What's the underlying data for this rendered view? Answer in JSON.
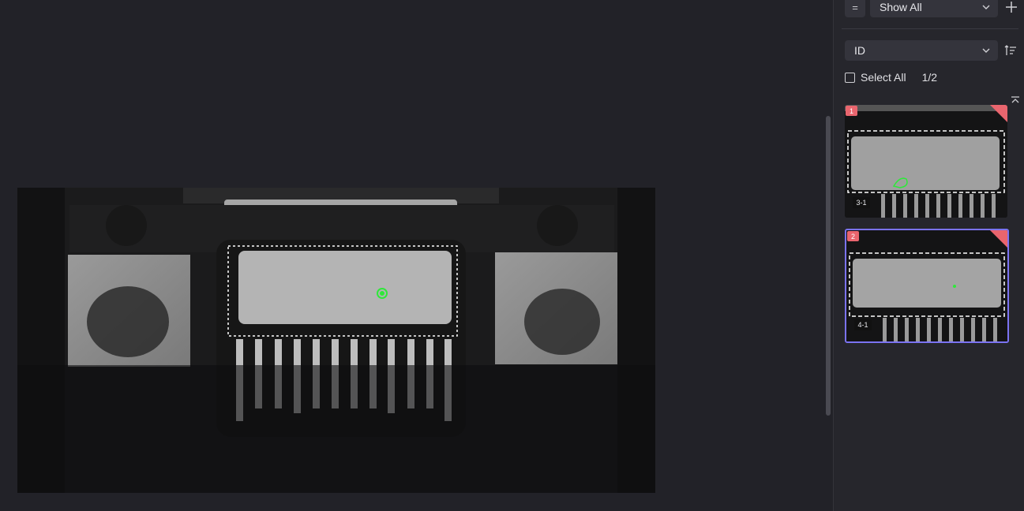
{
  "toolbar": {
    "eq_label": "=",
    "filter_value": "Show All",
    "sort_value": "ID"
  },
  "selection": {
    "select_all_label": "Select All",
    "count": "1/2"
  },
  "thumbnails": [
    {
      "index": "1",
      "label": "3-1",
      "selected": false
    },
    {
      "index": "2",
      "label": "4-1",
      "selected": true
    }
  ],
  "colors": {
    "accent": "#7b73f2",
    "flag": "#e9656e",
    "defect": "#2fe83a"
  }
}
